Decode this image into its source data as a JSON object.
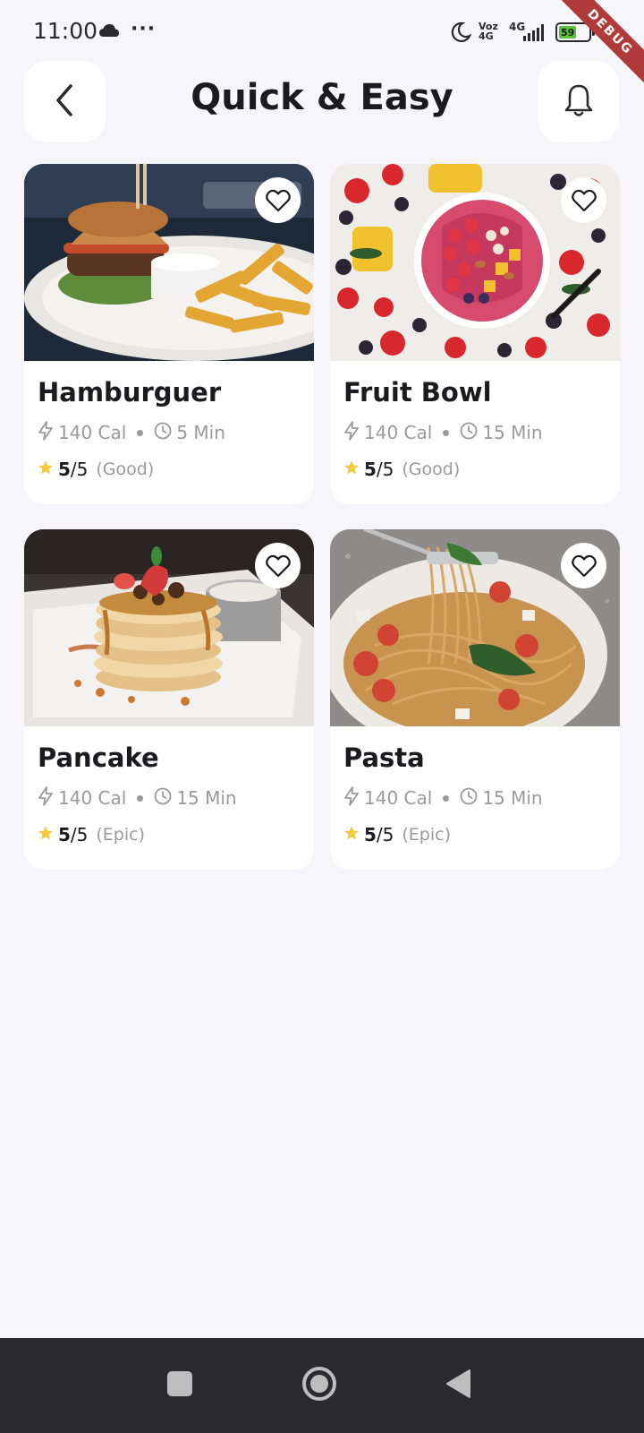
{
  "status_bar": {
    "time": "11:00",
    "more": "···",
    "volte_top": "Voz",
    "volte_bottom": "4G",
    "network": "4G",
    "battery": "59",
    "debug_banner": "DEBUG"
  },
  "header": {
    "title": "Quick & Easy"
  },
  "colors": {
    "background": "#F6F5FA",
    "card": "#FFFFFF",
    "star": "#F6C83A",
    "muted_text": "#9A9A9E",
    "nav_bar": "#2B2B2D",
    "debug_banner": "#B13A3A"
  },
  "icons": {
    "back": "chevron-left-icon",
    "bell": "bell-icon",
    "favorite": "heart-outline-icon",
    "calories": "lightning-icon",
    "time": "clock-icon",
    "rating": "star-icon"
  },
  "recipes": [
    {
      "name": "Hamburguer",
      "calories": "140 Cal",
      "time": "5 Min",
      "score": "5",
      "max": "/5",
      "label": "(Good)",
      "image": "hamburger-with-fries"
    },
    {
      "name": "Fruit Bowl",
      "calories": "140 Cal",
      "time": "15 Min",
      "score": "5",
      "max": "/5",
      "label": "(Good)",
      "image": "acai-fruit-bowl"
    },
    {
      "name": "Pancake",
      "calories": "140 Cal",
      "time": "15 Min",
      "score": "5",
      "max": "/5",
      "label": "(Epic)",
      "image": "pancake-stack"
    },
    {
      "name": "Pasta",
      "calories": "140 Cal",
      "time": "15 Min",
      "score": "5",
      "max": "/5",
      "label": "(Epic)",
      "image": "spaghetti-plate"
    }
  ],
  "nav_bar": {
    "items": [
      "recents-button",
      "home-button",
      "back-button"
    ]
  }
}
